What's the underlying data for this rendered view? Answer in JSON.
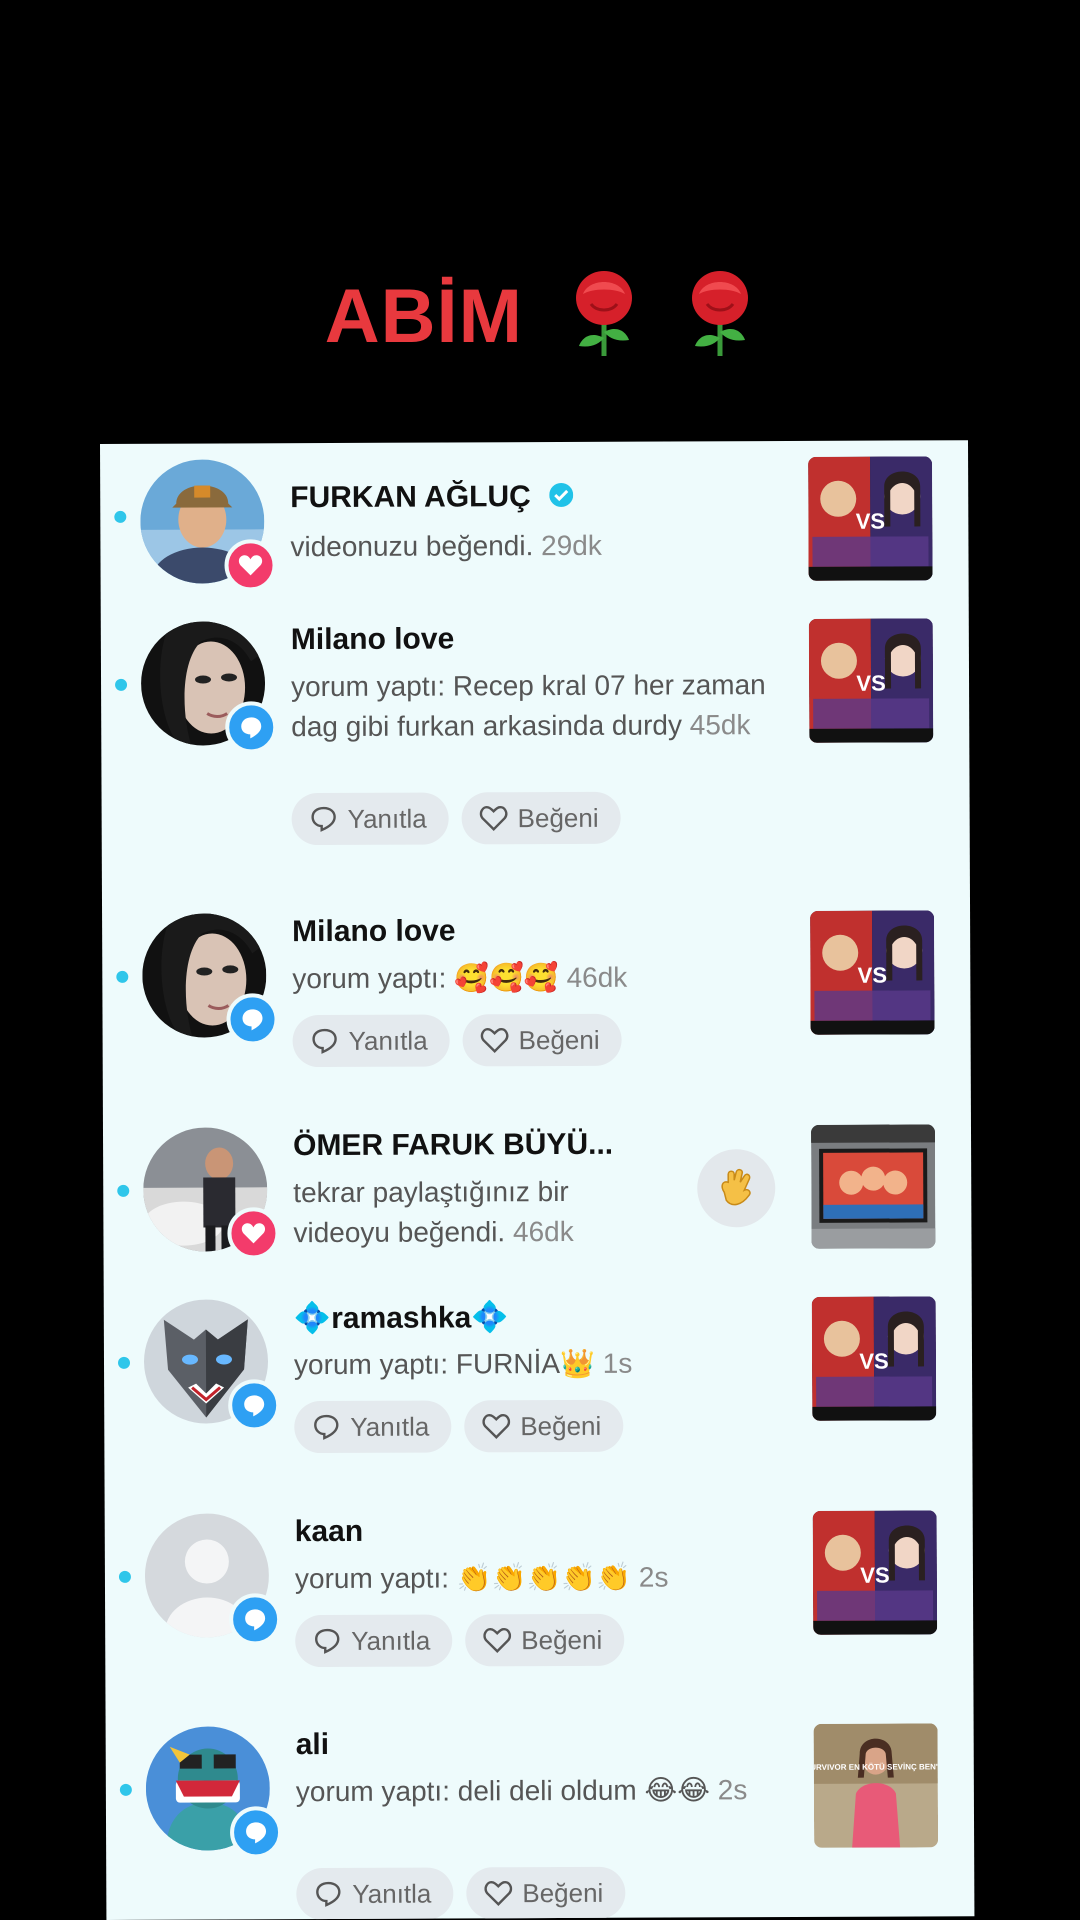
{
  "title": "ABİM",
  "buttons": {
    "reply": "Yanıtla",
    "like": "Beğeni"
  },
  "items": [
    {
      "name": "FURKAN AĞLUÇ",
      "text": "videonuzu beğendi.",
      "time": "29dk",
      "badge": "heart-icon",
      "verified": true
    },
    {
      "name": "Milano love",
      "text": "yorum yaptı: Recep kral 07 her zaman dag gibi furkan arkasinda durdy",
      "time": "45dk",
      "badge": "comment-icon"
    },
    {
      "name": "Milano love",
      "text": "yorum yaptı: 🥰🥰🥰",
      "time": "46dk",
      "badge": "comment-icon"
    },
    {
      "name": "ÖMER FARUK BÜYÜ...",
      "text": "tekrar paylaştığınız bir videoyu beğendi.",
      "time": "46dk",
      "badge": "heart-icon"
    },
    {
      "name": "💠ramashka💠",
      "text": "yorum yaptı: FURNİA👑",
      "time": "1s",
      "badge": "comment-icon"
    },
    {
      "name": "kaan",
      "text": "yorum yaptı: 👏👏👏👏👏",
      "time": "2s",
      "badge": "comment-icon"
    },
    {
      "name": "ali",
      "text": "yorum yaptı: deli deli oldum 😂😂",
      "time": "2s",
      "badge": "comment-icon"
    }
  ],
  "thumb7": {
    "caption": "SURVIVOR EN KÖTÜ SEVİNÇ BEN'İM"
  },
  "colors": {
    "title": "#e8393e",
    "heart_badge": "#f33b6b",
    "comment_badge": "#2ea0f3",
    "unread_dot": "#2fc6ea"
  }
}
